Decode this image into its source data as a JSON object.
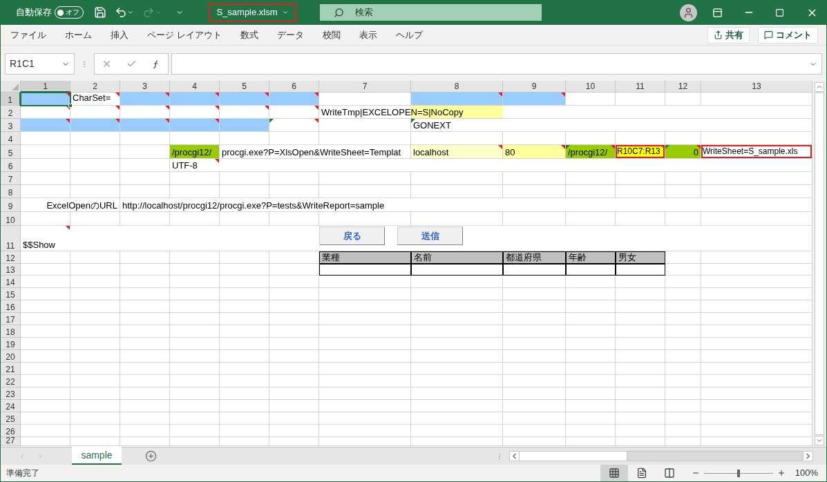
{
  "title_bar": {
    "autosave_label": "自動保存",
    "autosave": {
      "on": false,
      "label": "オフ"
    },
    "file_name": "S_sample.xlsm",
    "search_placeholder": "検索"
  },
  "ribbon_tabs": [
    {
      "label": "ファイル"
    },
    {
      "label": "ホーム"
    },
    {
      "label": "挿入"
    },
    {
      "label": "ページ レイアウト"
    },
    {
      "label": "数式"
    },
    {
      "label": "データ"
    },
    {
      "label": "校閲"
    },
    {
      "label": "表示"
    },
    {
      "label": "ヘルプ"
    }
  ],
  "ribbon_buttons": [
    {
      "kind": "share",
      "label": "共有"
    },
    {
      "kind": "comment",
      "label": "コメント"
    }
  ],
  "formula_bar": {
    "name_box": "R1C1"
  },
  "sheet": {
    "columns": [
      "1",
      "2",
      "3",
      "4",
      "5",
      "6",
      "7",
      "8",
      "9",
      "10",
      "11",
      "12",
      "13"
    ],
    "rows": [
      {
        "label": "1",
        "cells": [
          {
            "kind": "active",
            "color": "#99ccff",
            "note": true
          },
          {
            "text": "CharSet=",
            "kind": "wrap",
            "note": true
          },
          {
            "color": "#99ccff",
            "note": true
          },
          {
            "color": "#99ccff",
            "note": true
          },
          {
            "color": "#99ccff",
            "note": true
          },
          {
            "color": "#99ccff",
            "note": true
          },
          {},
          {
            "color": "#99ccff",
            "note": true
          },
          {
            "color": "#99ccff",
            "note": true
          }
        ]
      },
      {
        "label": "2",
        "cells": [
          {
            "note": true
          },
          {
            "note": true
          },
          {
            "note": true
          },
          {
            "note": true
          },
          {
            "note": true
          },
          {
            "note": true
          },
          {
            "text": "WriteTmp|EXCELOPEN=S|NoCopy"
          },
          {
            "color": "#ffff99"
          }
        ]
      },
      {
        "label": "3",
        "cells": [
          {
            "color": "#99ccff",
            "note": true
          },
          {
            "color": "#99ccff",
            "note": true
          },
          {
            "color": "#99ccff",
            "note": true
          },
          {
            "color": "#99ccff",
            "note": true
          },
          {
            "color": "#99ccff"
          },
          {
            "note": true,
            "flag": true
          },
          {},
          {
            "text": "GONEXT",
            "flag": true
          }
        ]
      },
      {
        "label": "4"
      },
      {
        "label": "5",
        "cells": [
          {},
          {},
          {},
          {
            "text": "/procgi12/",
            "color": "#99cc00"
          },
          {
            "text": "procgi.exe?P=XlsOpen&WriteSheet=Templat"
          },
          {},
          {},
          {
            "text": "localhost",
            "color": "#ffffcc",
            "note": true
          },
          {
            "text": "80",
            "color": "#ffff99",
            "note": true
          },
          {
            "text": "/procgi12/",
            "color": "#99cc00",
            "note": true,
            "flag": true
          },
          {
            "text": "R10C7:R13",
            "color": "#ffff00",
            "kind": "outlined",
            "note": true
          },
          {
            "text": "0",
            "color": "#99cc00",
            "kind": "number",
            "note": true,
            "flag": true
          },
          {
            "text": "WriteSheet=S_sample.xls",
            "kind": "outlined"
          }
        ]
      },
      {
        "label": "6",
        "cells": [
          {},
          {},
          {},
          {
            "text": "UTF-8",
            "note": true
          }
        ]
      },
      {
        "label": "7"
      },
      {
        "label": "8"
      },
      {
        "label": "9",
        "cells": [
          {},
          {
            "text": "ExcelOpenのURL",
            "kind": "right"
          },
          {
            "text": "http://localhost/procgi12/procgi.exe?P=tests&WriteReport=sample"
          }
        ]
      },
      {
        "label": "10"
      },
      {
        "label": "11",
        "cells": [
          {
            "text": "$$Show",
            "note": true
          }
        ],
        "buttons": [
          {
            "label": "戻る"
          },
          {
            "label": "送信"
          }
        ]
      },
      {
        "label": "12",
        "cells": [
          {},
          {},
          {},
          {},
          {},
          {},
          {
            "text": "業種",
            "kind": "head",
            "color": "#c0c0c0"
          },
          {
            "text": "名前",
            "kind": "head",
            "color": "#c0c0c0"
          },
          {
            "text": "都道府県",
            "kind": "head",
            "color": "#c0c0c0"
          },
          {
            "text": "年齢",
            "kind": "head",
            "color": "#c0c0c0"
          },
          {
            "text": "男女",
            "kind": "head",
            "color": "#c0c0c0"
          }
        ]
      },
      {
        "label": "13",
        "cells": [
          {},
          {},
          {},
          {},
          {},
          {},
          {
            "kind": "boxed"
          },
          {
            "kind": "boxed"
          },
          {
            "kind": "boxed"
          },
          {
            "kind": "boxed"
          },
          {
            "kind": "boxed"
          }
        ]
      },
      {
        "label": "14"
      },
      {
        "label": "15"
      },
      {
        "label": "16"
      },
      {
        "label": "17"
      },
      {
        "label": "18"
      },
      {
        "label": "19"
      },
      {
        "label": "20"
      },
      {
        "label": "21"
      },
      {
        "label": "22"
      },
      {
        "label": "23"
      },
      {
        "label": "24"
      },
      {
        "label": "25"
      },
      {
        "label": "26"
      },
      {
        "label": "27"
      }
    ]
  },
  "sheet_tabs": [
    {
      "label": "sample",
      "selected": true
    }
  ],
  "status_bar": {
    "status": "準備完了",
    "views": [
      {
        "kind": "normal",
        "selected": true
      },
      {
        "kind": "page-layout",
        "selected": false
      },
      {
        "kind": "page-break",
        "selected": false
      }
    ],
    "zoom": {
      "level": 0.5,
      "reading": "100%"
    }
  }
}
